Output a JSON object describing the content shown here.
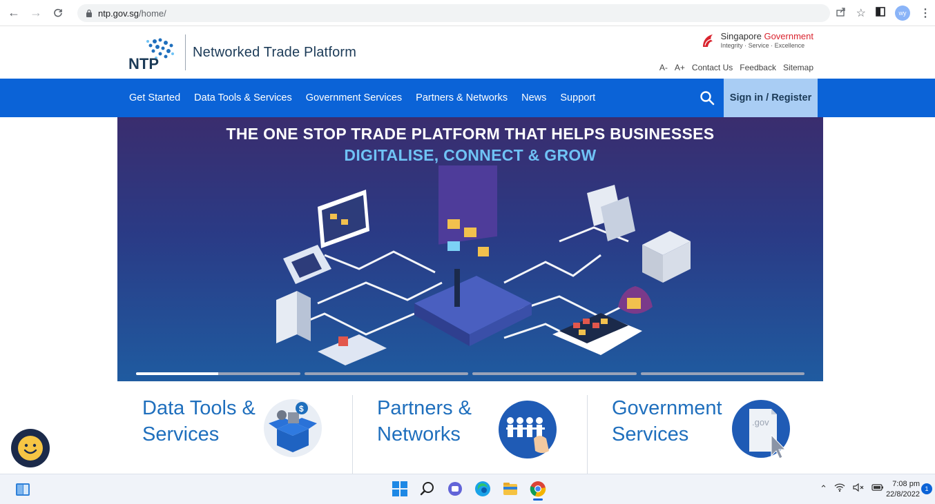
{
  "browser": {
    "url_host": "ntp.gov.sg",
    "url_path": "/home/",
    "profile_initials": "wy"
  },
  "header": {
    "logo_text": "Networked Trade Platform",
    "gov_line1_a": "Singapore ",
    "gov_line1_b": "Government",
    "gov_line2": "Integrity · Service · Excellence",
    "utility_links": [
      "A-",
      "A+",
      "Contact Us",
      "Feedback",
      "Sitemap"
    ]
  },
  "nav": {
    "items": [
      "Get Started",
      "Data Tools & Services",
      "Government Services",
      "Partners & Networks",
      "News",
      "Support"
    ],
    "signin_label": "Sign in / Register"
  },
  "hero": {
    "title_line1": "THE ONE STOP TRADE PLATFORM THAT HELPS BUSINESSES",
    "title_line2": "DIGITALISE, CONNECT & GROW",
    "slide_count": 4,
    "active_slide_progress": 0.5
  },
  "tiles": [
    {
      "line1": "Data Tools &",
      "line2": "Services",
      "icon": "box-icon"
    },
    {
      "line1": "Partners &",
      "line2": "Networks",
      "icon": "people-icon"
    },
    {
      "line1": "Government",
      "line2": "Services",
      "icon": "gov-document-icon"
    }
  ],
  "taskbar": {
    "time": "7:08 pm",
    "date": "22/8/2022",
    "notification_count": "1"
  },
  "colors": {
    "nav_blue": "#0b63d7",
    "signin_bg": "#a9cdf4",
    "tile_text": "#1f6fbd",
    "hero_cyan": "#6fc3f5"
  }
}
